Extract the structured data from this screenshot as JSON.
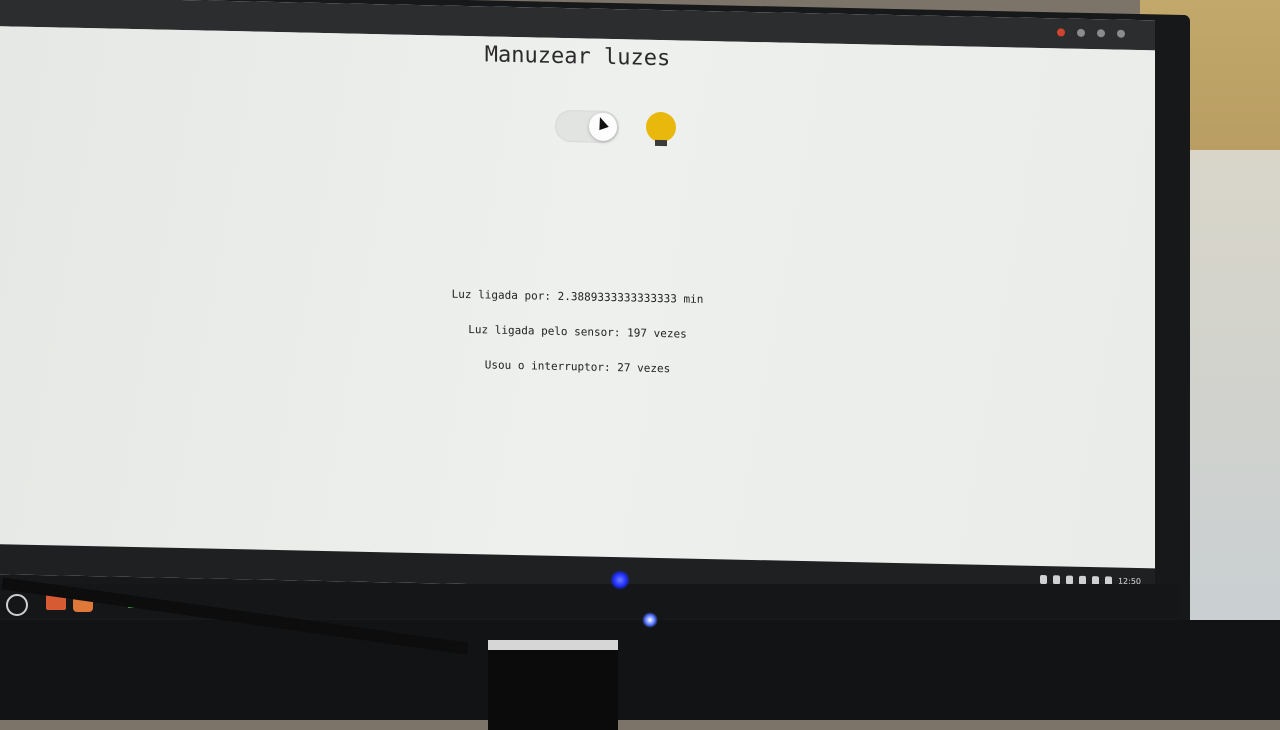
{
  "page": {
    "title": "Manuzear luzes",
    "stats": {
      "light_on_time": "Luz ligada por: 2.3889333333333333 min",
      "sensor_activations": "Luz ligada pelo sensor: 197 vezes",
      "switch_uses": "Usou o interruptor: 27 vezes"
    },
    "controls": {
      "toggle_state": "on",
      "bulb_color": "#e8b90c"
    }
  },
  "tray": {
    "clock": "12:50"
  }
}
